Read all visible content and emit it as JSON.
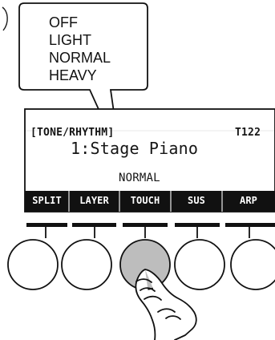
{
  "callout": {
    "options": [
      "OFF",
      "LIGHT",
      "NORMAL",
      "HEAVY"
    ]
  },
  "display": {
    "header_left": "[TONE/RHYTHM]",
    "header_right": "T122",
    "tone_name": "1:Stage Piano",
    "mode_value": "NORMAL",
    "function_labels": [
      "SPLIT",
      "LAYER",
      "TOUCH",
      "SUS",
      "ARP"
    ],
    "pressed_button": "TOUCH"
  },
  "colors": {
    "background": "#ffffff",
    "display_bar": "#111111",
    "button_border": "#222222",
    "pressed_button_fill": "#bdbdbd",
    "text": "#111111"
  }
}
